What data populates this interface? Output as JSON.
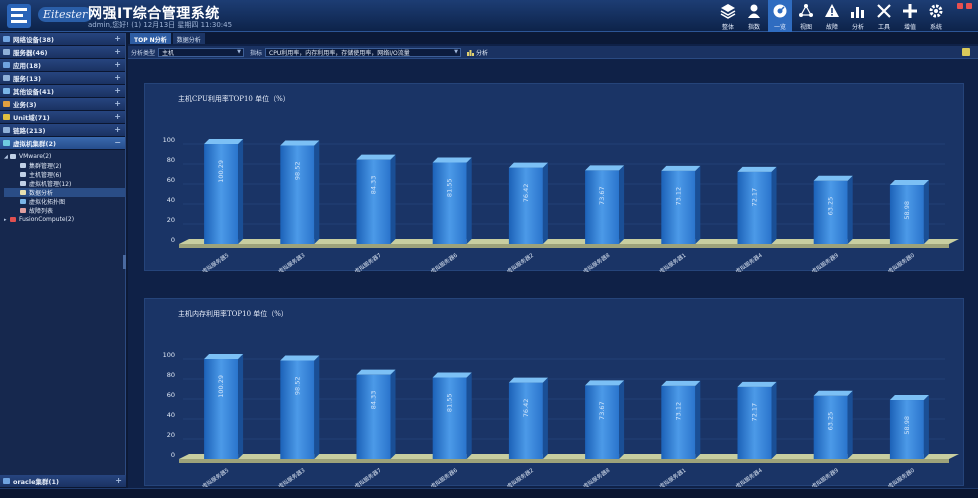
{
  "header": {
    "title": "网强IT综合管理系统",
    "brand": "Eitester",
    "user_info": "admin,您好! (1) 12月13日 星期四 11:30:45",
    "nav": [
      {
        "label": "整体",
        "icon": "layers-icon",
        "active": false
      },
      {
        "label": "指数",
        "icon": "user-icon",
        "active": false
      },
      {
        "label": "一览",
        "icon": "dashboard-icon",
        "active": true
      },
      {
        "label": "视图",
        "icon": "topology-icon",
        "active": false
      },
      {
        "label": "故障",
        "icon": "warning-icon",
        "active": false
      },
      {
        "label": "分析",
        "icon": "bar-chart-icon",
        "active": false
      },
      {
        "label": "工具",
        "icon": "tools-icon",
        "active": false
      },
      {
        "label": "增值",
        "icon": "plus-icon",
        "active": false
      },
      {
        "label": "系统",
        "icon": "gear-icon",
        "active": false
      }
    ]
  },
  "sidebar": {
    "sections": [
      {
        "label": "网络设备(38)",
        "icon": "network-icon",
        "color": "#6fa3e0",
        "toggle": "+"
      },
      {
        "label": "服务器(46)",
        "icon": "server-icon",
        "color": "#8fb0d8",
        "toggle": "+"
      },
      {
        "label": "应用(18)",
        "icon": "app-icon",
        "color": "#6fa3e0",
        "toggle": "+"
      },
      {
        "label": "服务(13)",
        "icon": "service-icon",
        "color": "#8fb0d8",
        "toggle": "+"
      },
      {
        "label": "其他设备(41)",
        "icon": "device-icon",
        "color": "#7ab5e8",
        "toggle": "+"
      },
      {
        "label": "业务(3)",
        "icon": "business-icon",
        "color": "#e0a040",
        "toggle": "+"
      },
      {
        "label": "Unit域(71)",
        "icon": "unit-icon",
        "color": "#e0c040",
        "toggle": "+"
      },
      {
        "label": "链路(213)",
        "icon": "link-icon",
        "color": "#8fb0d8",
        "toggle": "+"
      },
      {
        "label": "虚拟机集群(2)",
        "icon": "cluster-icon",
        "color": "#6fcde0",
        "toggle": "−",
        "active": true
      }
    ],
    "tree": [
      {
        "label": "VMware(2)",
        "level": 1,
        "caret": "◢",
        "color": "#c0d0e6"
      },
      {
        "label": "集群管理(2)",
        "level": 2,
        "caret": "",
        "color": "#c0d0e6"
      },
      {
        "label": "主机管理(6)",
        "level": 2,
        "caret": "",
        "color": "#c0d0e6"
      },
      {
        "label": "虚拟机管理(12)",
        "level": 2,
        "caret": "",
        "color": "#c0d0e6"
      },
      {
        "label": "数据分析",
        "level": 2,
        "caret": "",
        "color": "#e8e0b0",
        "selected": true
      },
      {
        "label": "虚拟化拓扑图",
        "level": 2,
        "caret": "",
        "color": "#7ab5e8"
      },
      {
        "label": "故障列表",
        "level": 2,
        "caret": "",
        "color": "#e0a0a0"
      },
      {
        "label": "FusionCompute(2)",
        "level": 1,
        "caret": "▸",
        "color": "#e05050"
      }
    ],
    "bottom": {
      "label": "oracle集群(1)",
      "icon": "oracle-icon",
      "color": "#6fa3e0",
      "toggle": "+"
    }
  },
  "main": {
    "tabs": [
      {
        "label": "TOP N分析",
        "active": true
      },
      {
        "label": "数据分析",
        "active": false
      }
    ],
    "toolbar": {
      "type_label": "分析类型",
      "type_value": "主机",
      "metric_label": "指标",
      "metric_value": "CPU利用率，内存利用率，存储使用率，网络I/O流量",
      "analyze_label": "分析"
    }
  },
  "chart_data": [
    {
      "type": "bar",
      "title": "主机CPU利用率TOP10 单位（%）",
      "ylim": [
        0,
        100
      ],
      "yticks": [
        0,
        20,
        40,
        60,
        80,
        100
      ],
      "categories": [
        "虚拟服务器5",
        "虚拟服务器3",
        "虚拟服务器7",
        "虚拟服务器6",
        "虚拟服务器2",
        "虚拟服务器8",
        "虚拟服务器1",
        "虚拟服务器4",
        "虚拟服务器9",
        "虚拟服务器0"
      ],
      "values": [
        100.29,
        98.52,
        84.33,
        81.55,
        76.42,
        73.67,
        73.12,
        72.17,
        63.25,
        58.98
      ],
      "data_labels": [
        "100.29",
        "98.52",
        "84.33",
        "81.55",
        "76.42",
        "73.67",
        "73.12",
        "72.17",
        "63.25",
        "58.98"
      ],
      "grid": true,
      "color": "#2f7fd8"
    },
    {
      "type": "bar",
      "title": "主机内存利用率TOP10 单位（%）",
      "ylim": [
        0,
        100
      ],
      "yticks": [
        0,
        20,
        40,
        60,
        80,
        100
      ],
      "categories": [
        "虚拟服务器5",
        "虚拟服务器3",
        "虚拟服务器7",
        "虚拟服务器6",
        "虚拟服务器2",
        "虚拟服务器8",
        "虚拟服务器1",
        "虚拟服务器4",
        "虚拟服务器9",
        "虚拟服务器0"
      ],
      "values": [
        100.29,
        98.52,
        84.33,
        81.55,
        76.42,
        73.67,
        73.12,
        72.17,
        63.25,
        58.98
      ],
      "data_labels": [
        "100.29",
        "98.52",
        "84.33",
        "81.55",
        "76.42",
        "73.67",
        "73.12",
        "72.17",
        "63.25",
        "58.98"
      ],
      "grid": true,
      "color": "#2f7fd8"
    }
  ]
}
